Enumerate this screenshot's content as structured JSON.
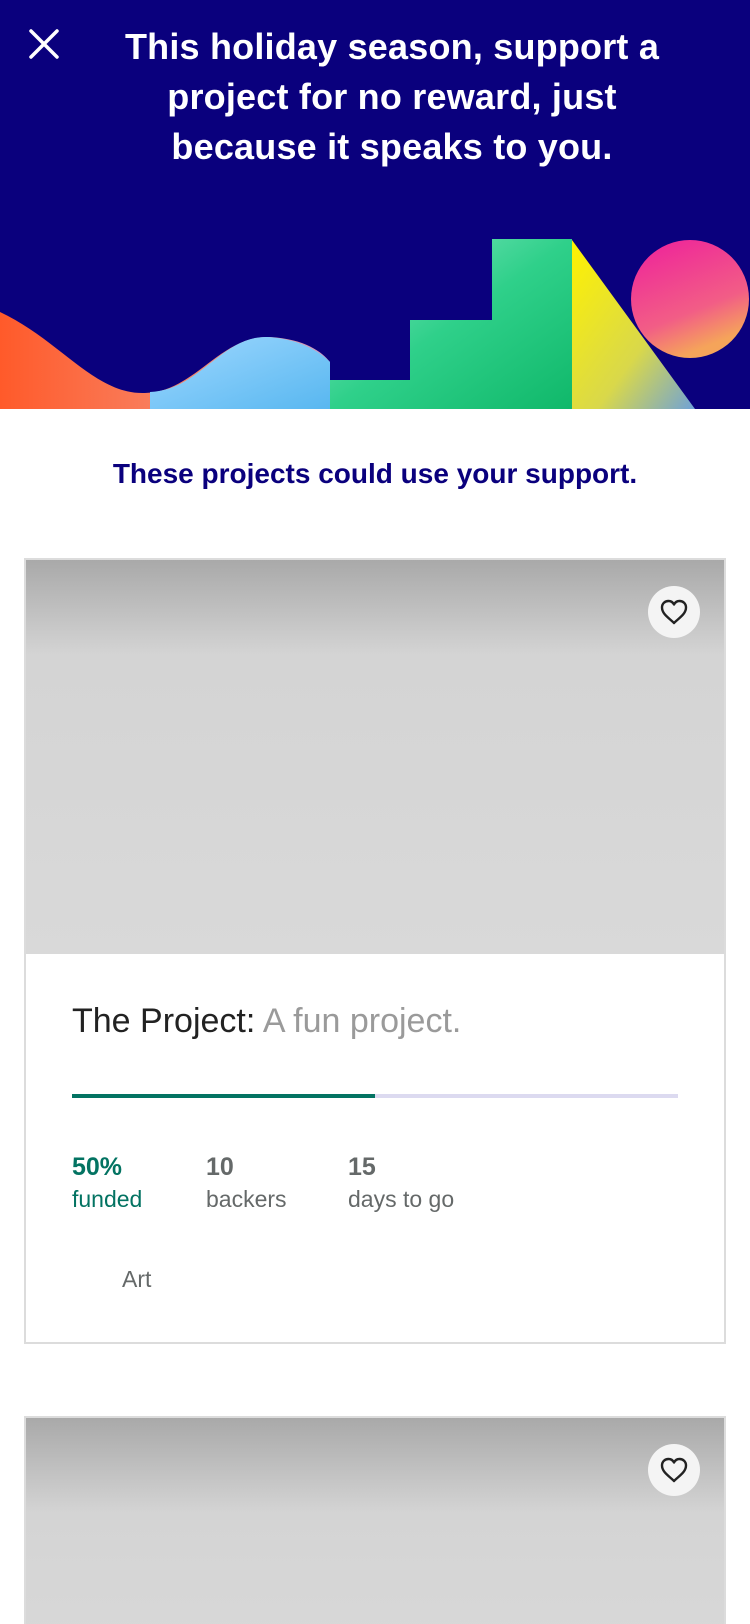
{
  "header": {
    "title": "This holiday season, support a project for no reward, just because it speaks to you.",
    "background_color": "#0a007d"
  },
  "subtitle": "These projects could use your support.",
  "projects": [
    {
      "name": "The Project:",
      "blurb": "A fun project.",
      "percent_funded": 50,
      "funded_value": "50%",
      "funded_label": "funded",
      "backers_value": "10",
      "backers_label": "backers",
      "days_value": "15",
      "days_label": "days to go",
      "category": "Art"
    }
  ],
  "colors": {
    "accent_green": "#037362",
    "brand_navy": "#0a007d",
    "progress_track": "#dcdaf0"
  },
  "icons": {
    "close": "close-icon",
    "save": "heart-icon"
  }
}
